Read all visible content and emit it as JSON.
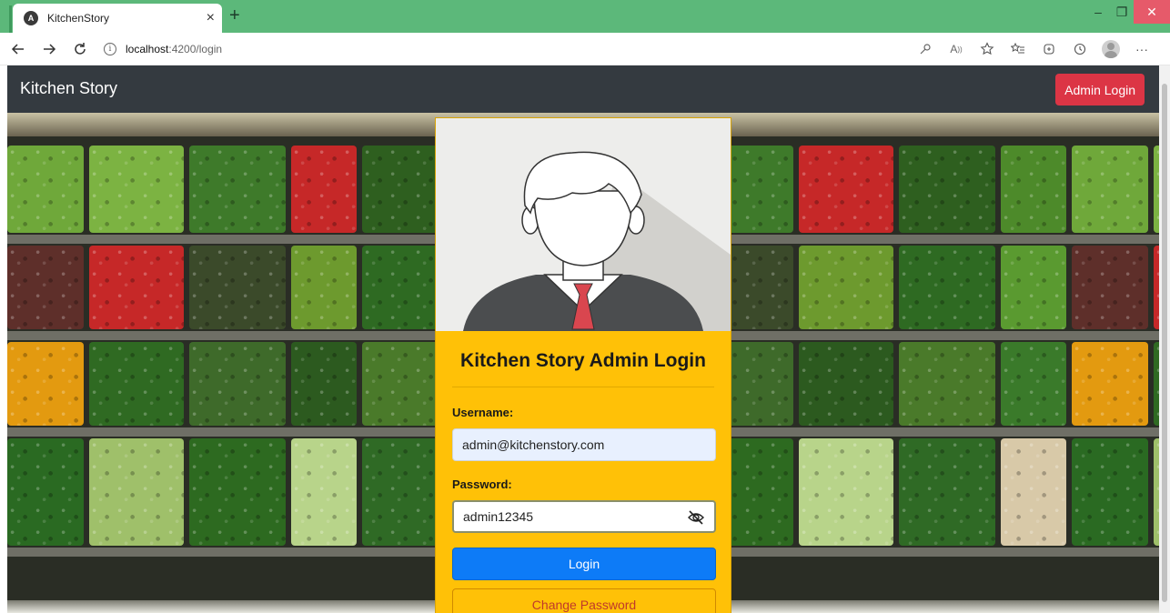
{
  "browser": {
    "tab_title": "KitchenStory",
    "tab_favicon_letter": "A",
    "url_host": "localhost",
    "url_rest": ":4200/login"
  },
  "navbar": {
    "brand": "Kitchen Story",
    "admin_login_label": "Admin Login"
  },
  "login": {
    "title": "Kitchen Story Admin Login",
    "username_label": "Username:",
    "username_value": "admin@kitchenstory.com",
    "password_label": "Password:",
    "password_value": "admin12345",
    "login_button": "Login",
    "change_password_button": "Change Password"
  },
  "colors": {
    "navbar_bg": "#343a40",
    "card_bg": "#ffc107",
    "login_btn": "#0d7bf7",
    "admin_btn": "#dc3545",
    "tab_strip": "#5cb87a"
  },
  "icons": [
    "back-arrow-icon",
    "forward-arrow-icon",
    "reload-icon",
    "info-icon",
    "eye-slash-icon",
    "user-avatar-icon"
  ]
}
